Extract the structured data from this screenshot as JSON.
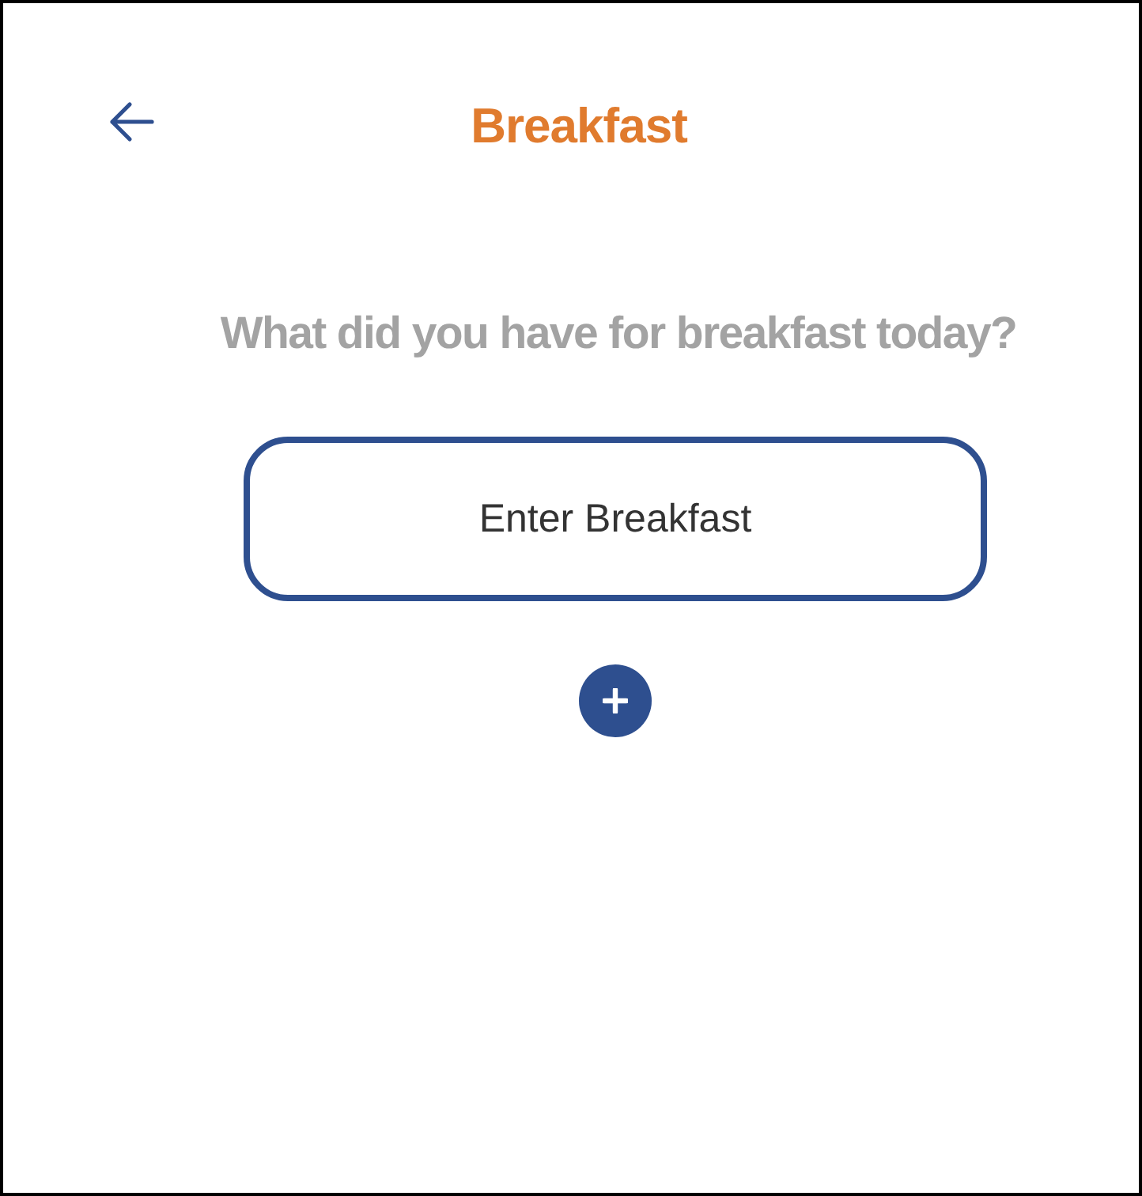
{
  "header": {
    "title": "Breakfast"
  },
  "question": "What did you have for breakfast today?",
  "entry": {
    "placeholder": "Enter Breakfast"
  }
}
